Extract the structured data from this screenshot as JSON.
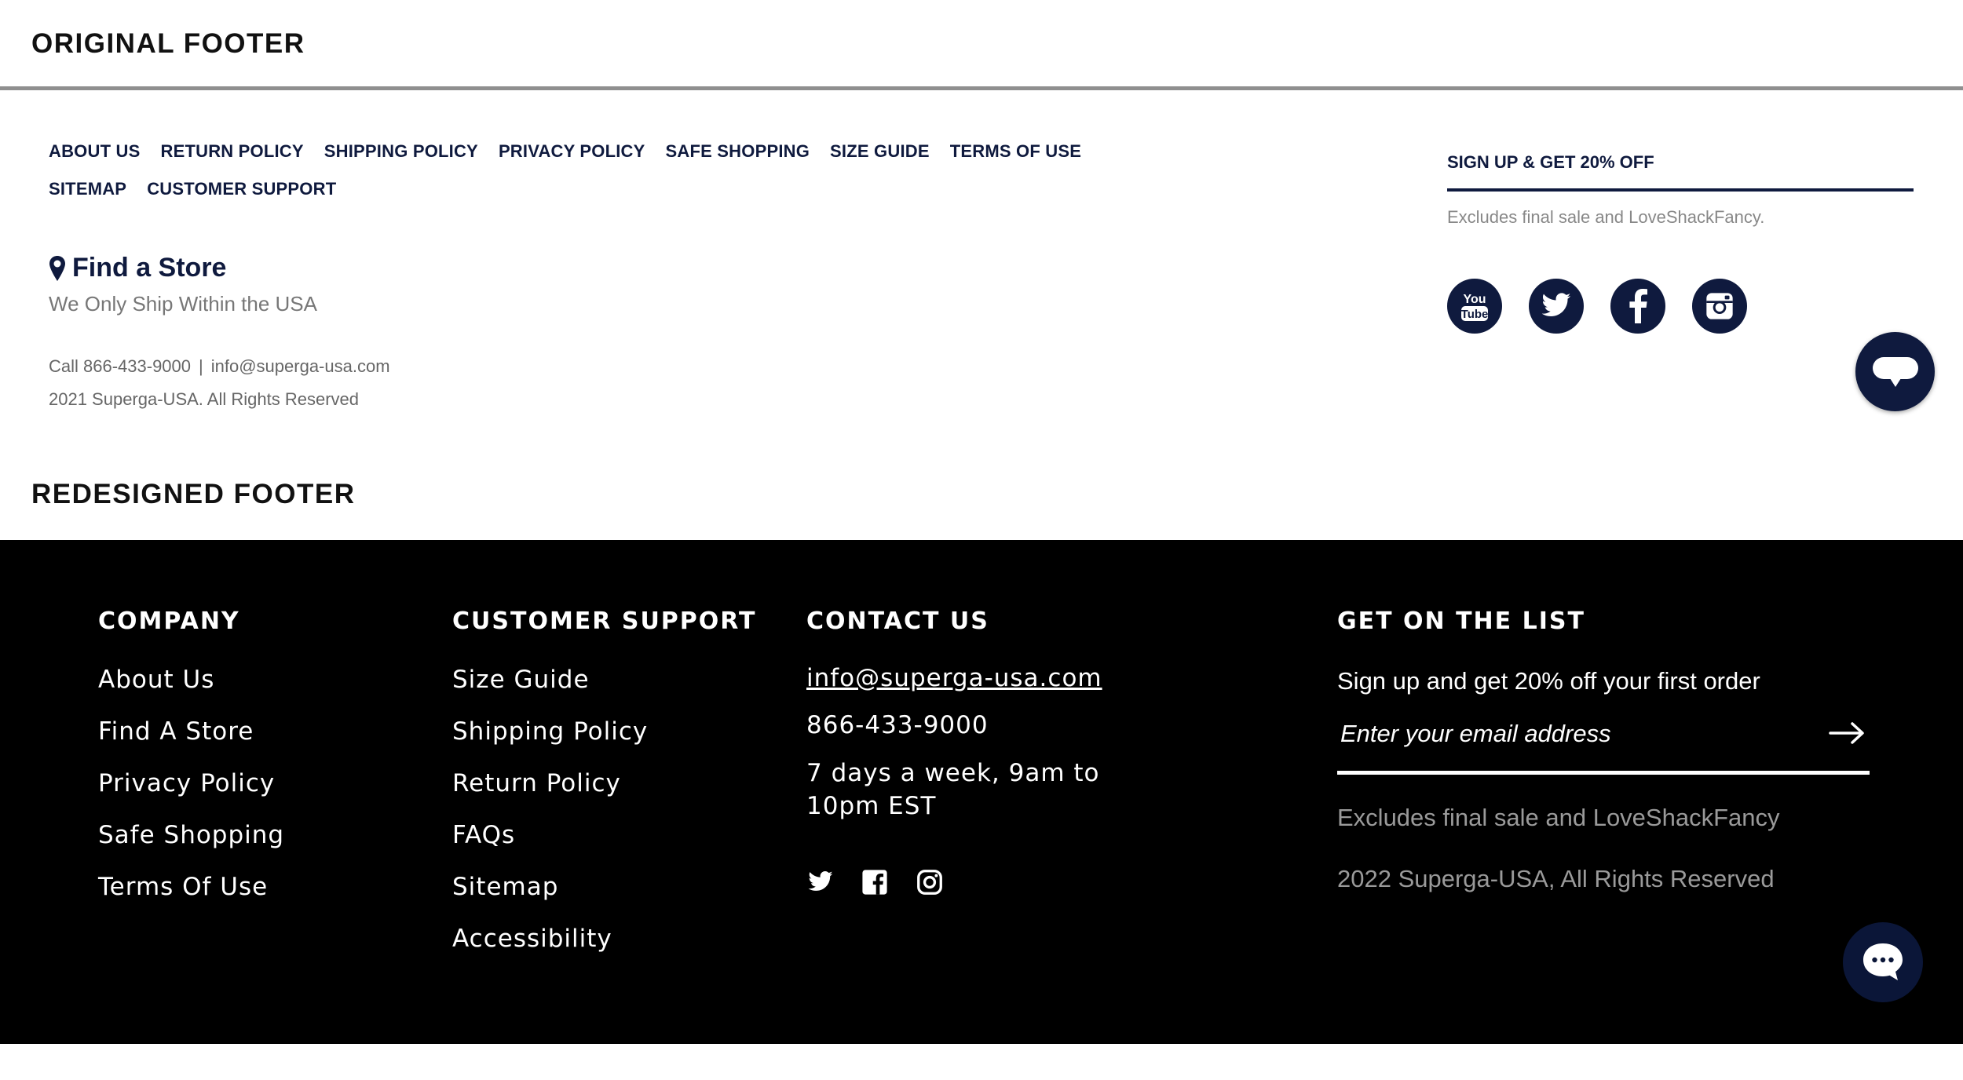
{
  "original": {
    "heading": "ORIGINAL FOOTER",
    "links_row1": [
      "ABOUT US",
      "RETURN POLICY",
      "SHIPPING POLICY",
      "PRIVACY POLICY",
      "SAFE SHOPPING",
      "SIZE GUIDE",
      "TERMS OF USE"
    ],
    "links_row2": [
      "SITEMAP",
      "CUSTOMER SUPPORT"
    ],
    "find_store": "Find a Store",
    "ship_note": "We Only Ship Within the USA",
    "call": "Call 866-433-9000",
    "separator": "|",
    "email": "info@superga-usa.com",
    "copyright": "2021 Superga-USA. All Rights Reserved",
    "signup_title": "SIGN UP & GET 20% OFF",
    "signup_excludes": "Excludes final sale and LoveShackFancy.",
    "social": [
      "youtube-icon",
      "twitter-icon",
      "facebook-icon",
      "instagram-icon"
    ],
    "youtube_text": [
      "You",
      "Tube"
    ],
    "brand_color": "#0f1a3e"
  },
  "redesign": {
    "heading": "REDESIGNED FOOTER",
    "company": {
      "title": "COMPANY",
      "links": [
        "About Us",
        "Find A Store",
        "Privacy Policy",
        "Safe Shopping",
        "Terms Of Use"
      ]
    },
    "support": {
      "title": "CUSTOMER SUPPORT",
      "links": [
        "Size Guide",
        "Shipping Policy",
        "Return Policy",
        "FAQs",
        "Sitemap",
        "Accessibility"
      ]
    },
    "contact": {
      "title": "CONTACT US",
      "email": "info@superga-usa.com",
      "phone": "866-433-9000",
      "hours": "7 days a week, 9am to 10pm EST",
      "social": [
        "twitter-icon",
        "facebook-icon",
        "instagram-icon"
      ]
    },
    "list": {
      "title": "GET ON THE LIST",
      "subtitle": "Sign up and get 20% off your first order",
      "email_placeholder": "Enter your email address",
      "excludes": "Excludes final sale and LoveShackFancy",
      "copyright": "2022 Superga-USA, All Rights Reserved"
    },
    "background": "#000000",
    "chat_color": "#0b1638"
  }
}
